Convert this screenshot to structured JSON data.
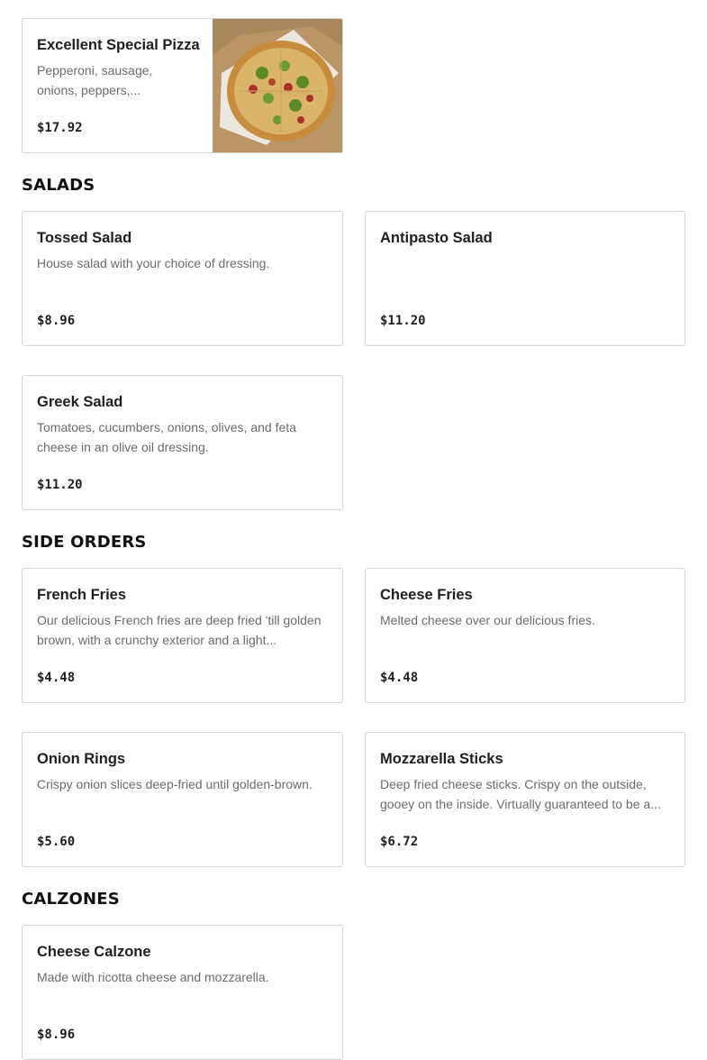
{
  "featured": {
    "name": "Excellent Special Pizza",
    "description": "Pepperoni, sausage, onions, peppers,...",
    "price": "$17.92",
    "image_icon": "pizza-photo"
  },
  "sections": [
    {
      "heading": "SALADS",
      "items": [
        {
          "name": "Tossed Salad",
          "description": "House salad with your choice of dressing.",
          "price": "$8.96"
        },
        {
          "name": "Antipasto Salad",
          "description": "",
          "price": "$11.20"
        },
        {
          "name": "Greek Salad",
          "description": "Tomatoes, cucumbers, onions, olives, and feta cheese in an olive oil dressing.",
          "price": "$11.20"
        }
      ]
    },
    {
      "heading": "SIDE ORDERS",
      "items": [
        {
          "name": "French Fries",
          "description": "Our delicious French fries are deep fried 'till golden brown, with a crunchy exterior and a light...",
          "price": "$4.48"
        },
        {
          "name": "Cheese Fries",
          "description": "Melted cheese over our delicious fries.",
          "price": "$4.48"
        },
        {
          "name": "Onion Rings",
          "description": "Crispy onion slices deep-fried until golden-brown.",
          "price": "$5.60"
        },
        {
          "name": "Mozzarella Sticks",
          "description": "Deep fried cheese sticks. Crispy on the outside, gooey on the inside. Virtually guaranteed to be a...",
          "price": "$6.72"
        }
      ]
    },
    {
      "heading": "CALZONES",
      "items": [
        {
          "name": "Cheese Calzone",
          "description": "Made with ricotta cheese and mozzarella.",
          "price": "$8.96"
        }
      ]
    }
  ]
}
